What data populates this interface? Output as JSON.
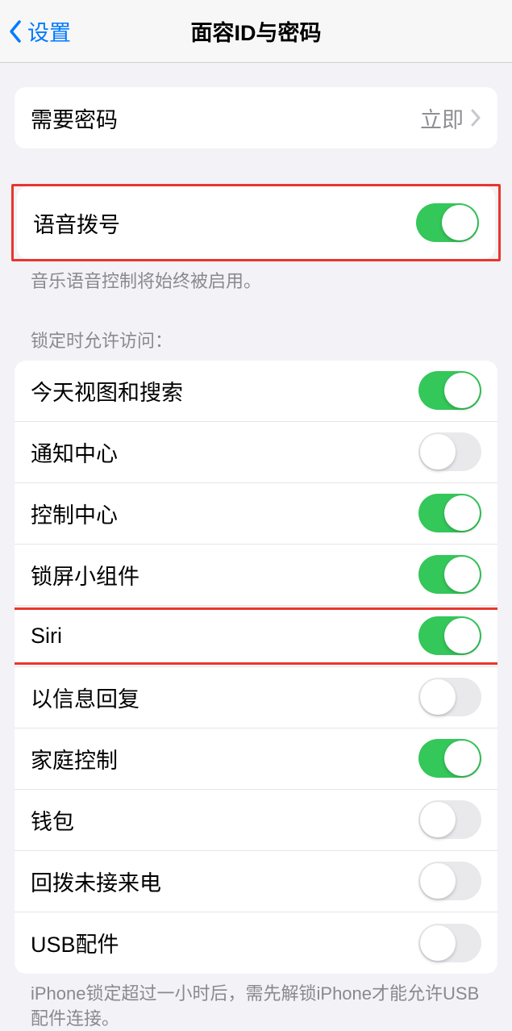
{
  "header": {
    "back_label": "设置",
    "title": "面容ID与密码"
  },
  "require_passcode": {
    "label": "需要密码",
    "value": "立即"
  },
  "voice_dial": {
    "label": "语音拨号",
    "on": true,
    "footer": "音乐语音控制将始终被启用。"
  },
  "lock_section": {
    "header": "锁定时允许访问：",
    "items": [
      {
        "label": "今天视图和搜索",
        "on": true,
        "highlight": false
      },
      {
        "label": "通知中心",
        "on": false,
        "highlight": false
      },
      {
        "label": "控制中心",
        "on": true,
        "highlight": false
      },
      {
        "label": "锁屏小组件",
        "on": true,
        "highlight": false
      },
      {
        "label": "Siri",
        "on": true,
        "highlight": true
      },
      {
        "label": "以信息回复",
        "on": false,
        "highlight": false
      },
      {
        "label": "家庭控制",
        "on": true,
        "highlight": false
      },
      {
        "label": "钱包",
        "on": false,
        "highlight": false
      },
      {
        "label": "回拨未接来电",
        "on": false,
        "highlight": false
      },
      {
        "label": "USB配件",
        "on": false,
        "highlight": false
      }
    ],
    "footer": "iPhone锁定超过一小时后，需先解锁iPhone才能允许USB配件连接。"
  }
}
